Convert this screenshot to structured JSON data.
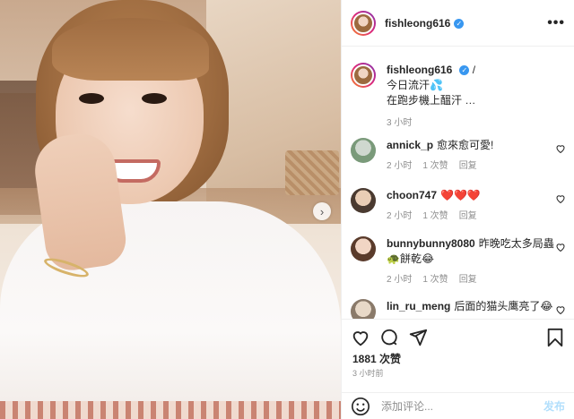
{
  "post": {
    "username": "fishleong616",
    "more_icon": "more-horizontal-icon",
    "verified_icon": "verified-badge-icon"
  },
  "caption": {
    "username": "fishleong616",
    "line1": "今日流汗💦",
    "line2": "在跑步機上醞汗 …",
    "time": "3 小时"
  },
  "comments": [
    {
      "username": "annick_p",
      "text": "愈來愈可愛!",
      "time": "2 小时",
      "likes": "1 次赞",
      "reply": "回复"
    },
    {
      "username": "choon747",
      "text": "❤️❤️❤️",
      "time": "2 小时",
      "likes": "1 次赞",
      "reply": "回复"
    },
    {
      "username": "bunnybunny8080",
      "text": "昨晚吃太多局蟲🐢餅乾😂",
      "time": "2 小时",
      "likes": "1 次赞",
      "reply": "回复"
    },
    {
      "username": "lin_ru_meng",
      "text": "后面的猫头鹰亮了😂",
      "time": "",
      "likes": "",
      "reply": ""
    }
  ],
  "likes_count": "1881 次赞",
  "post_time": "3 小时前",
  "add_comment": {
    "placeholder": "添加评论...",
    "post_label": "发布"
  },
  "icons": [
    "heart-icon",
    "comment-icon",
    "share-icon",
    "bookmark-icon",
    "emoji-icon",
    "chevron-right-icon"
  ]
}
